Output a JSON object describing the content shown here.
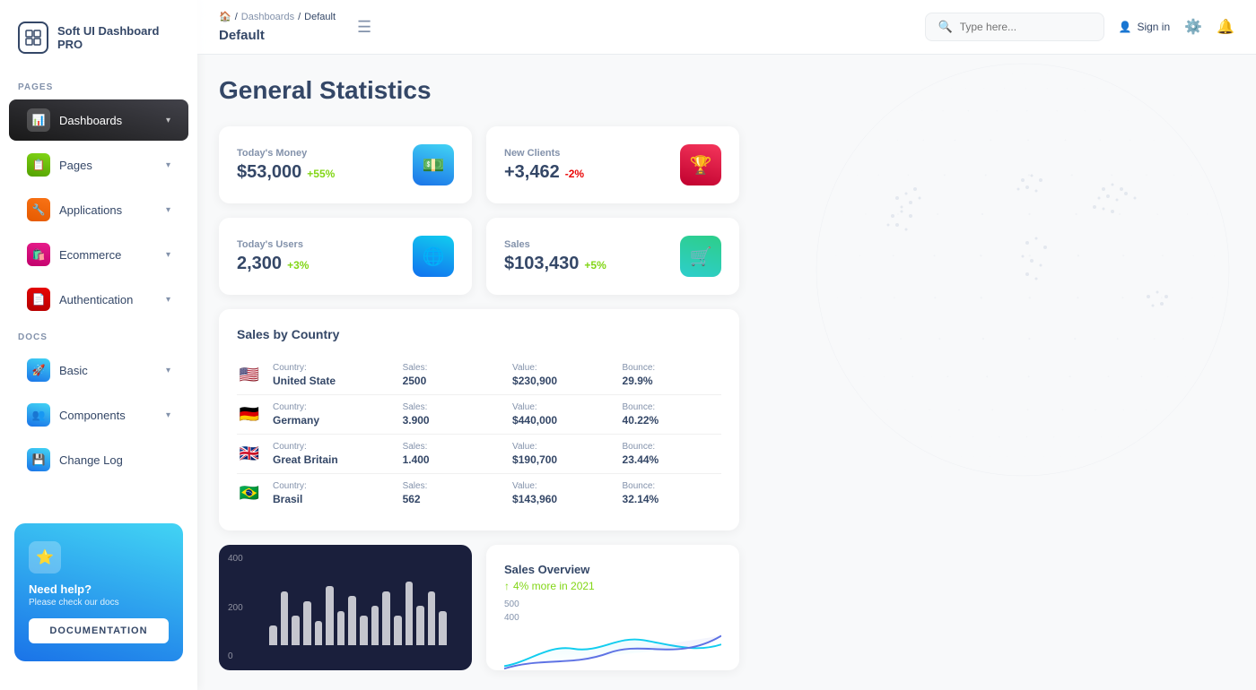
{
  "app": {
    "name": "Soft UI Dashboard PRO"
  },
  "sidebar": {
    "section_pages": "PAGES",
    "section_docs": "DOCS",
    "items_pages": [
      {
        "id": "dashboards",
        "label": "Dashboards",
        "icon": "📊",
        "active": true,
        "hasChevron": true
      },
      {
        "id": "pages",
        "label": "Pages",
        "icon": "📋",
        "active": false,
        "hasChevron": true
      },
      {
        "id": "applications",
        "label": "Applications",
        "icon": "🔧",
        "active": false,
        "hasChevron": true
      },
      {
        "id": "ecommerce",
        "label": "Ecommerce",
        "icon": "🛍️",
        "active": false,
        "hasChevron": true
      },
      {
        "id": "authentication",
        "label": "Authentication",
        "icon": "📄",
        "active": false,
        "hasChevron": true
      }
    ],
    "items_docs": [
      {
        "id": "basic",
        "label": "Basic",
        "icon": "🚀",
        "active": false,
        "hasChevron": true
      },
      {
        "id": "components",
        "label": "Components",
        "icon": "👥",
        "active": false,
        "hasChevron": true
      },
      {
        "id": "changelog",
        "label": "Change Log",
        "icon": "💾",
        "active": false,
        "hasChevron": false
      }
    ]
  },
  "help_card": {
    "title": "Need help?",
    "subtitle": "Please check our docs",
    "button_label": "DOCUMENTATION"
  },
  "topbar": {
    "breadcrumb_home": "🏠",
    "breadcrumb_sep1": "/",
    "breadcrumb_dashboards": "Dashboards",
    "breadcrumb_sep2": "/",
    "breadcrumb_current": "Default",
    "page_title": "Default",
    "search_placeholder": "Type here...",
    "signin_label": "Sign in"
  },
  "page": {
    "title": "General Statistics"
  },
  "stats": [
    {
      "id": "money",
      "label": "Today's Money",
      "value": "$53,000",
      "change": "+55%",
      "change_type": "positive",
      "icon": "💵"
    },
    {
      "id": "clients",
      "label": "New Clients",
      "value": "+3,462",
      "change": "-2%",
      "change_type": "negative",
      "icon": "🏆"
    },
    {
      "id": "users",
      "label": "Today's Users",
      "value": "2,300",
      "change": "+3%",
      "change_type": "positive",
      "icon": "🌐"
    },
    {
      "id": "sales",
      "label": "Sales",
      "value": "$103,430",
      "change": "+5%",
      "change_type": "positive",
      "icon": "🛒"
    }
  ],
  "sales_by_country": {
    "title": "Sales by Country",
    "columns": {
      "country": "Country:",
      "sales": "Sales:",
      "value": "Value:",
      "bounce": "Bounce:"
    },
    "rows": [
      {
        "flag": "🇺🇸",
        "country": "United State",
        "sales": "2500",
        "value": "$230,900",
        "bounce": "29.9%"
      },
      {
        "flag": "🇩🇪",
        "country": "Germany",
        "sales": "3.900",
        "value": "$440,000",
        "bounce": "40.22%"
      },
      {
        "flag": "🇬🇧",
        "country": "Great Britain",
        "sales": "1.400",
        "value": "$190,700",
        "bounce": "23.44%"
      },
      {
        "flag": "🇧🇷",
        "country": "Brasil",
        "sales": "562",
        "value": "$143,960",
        "bounce": "32.14%"
      }
    ]
  },
  "chart": {
    "y_labels": [
      "400",
      "200",
      "0"
    ],
    "bars": [
      20,
      55,
      30,
      45,
      25,
      60,
      35,
      50,
      30,
      40,
      55,
      30,
      65,
      40,
      55,
      35
    ]
  },
  "sales_overview": {
    "title": "Sales Overview",
    "change": "4% more in 2021",
    "y_labels": [
      "500",
      "400"
    ]
  }
}
